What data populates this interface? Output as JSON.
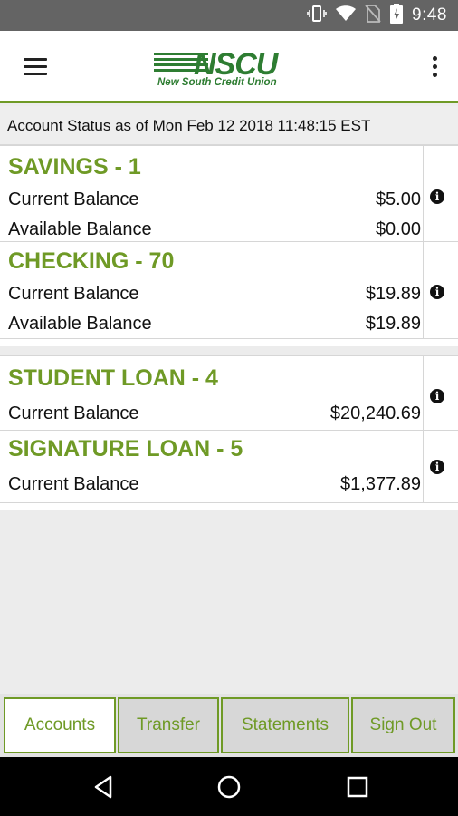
{
  "status_bar": {
    "time": "9:48",
    "icons": [
      "vibrate-icon",
      "wifi-icon",
      "no-sim-icon",
      "battery-charging-icon"
    ]
  },
  "header": {
    "logo_text": "NSCU",
    "logo_subtitle": "New South Credit Union",
    "brand_color": "#6f9a26"
  },
  "account_status": "Account Status as of Mon Feb 12 2018 11:48:15 EST",
  "deposit_accounts": [
    {
      "title": "SAVINGS - 1",
      "rows": [
        {
          "label": "Current Balance",
          "amount": "$5.00"
        },
        {
          "label": "Available Balance",
          "amount": "$0.00"
        }
      ]
    },
    {
      "title": "CHECKING - 70",
      "rows": [
        {
          "label": "Current Balance",
          "amount": "$19.89"
        },
        {
          "label": "Available Balance",
          "amount": "$19.89"
        }
      ]
    }
  ],
  "loan_accounts": [
    {
      "title": "STUDENT LOAN - 4",
      "rows": [
        {
          "label": "Current Balance",
          "amount": "$20,240.69"
        }
      ]
    },
    {
      "title": "SIGNATURE LOAN - 5",
      "rows": [
        {
          "label": "Current Balance",
          "amount": "$1,377.89"
        }
      ]
    }
  ],
  "tabs": [
    {
      "label": "Accounts",
      "active": true
    },
    {
      "label": "Transfer",
      "active": false
    },
    {
      "label": "Statements",
      "active": false
    },
    {
      "label": "Sign Out",
      "active": false
    }
  ]
}
